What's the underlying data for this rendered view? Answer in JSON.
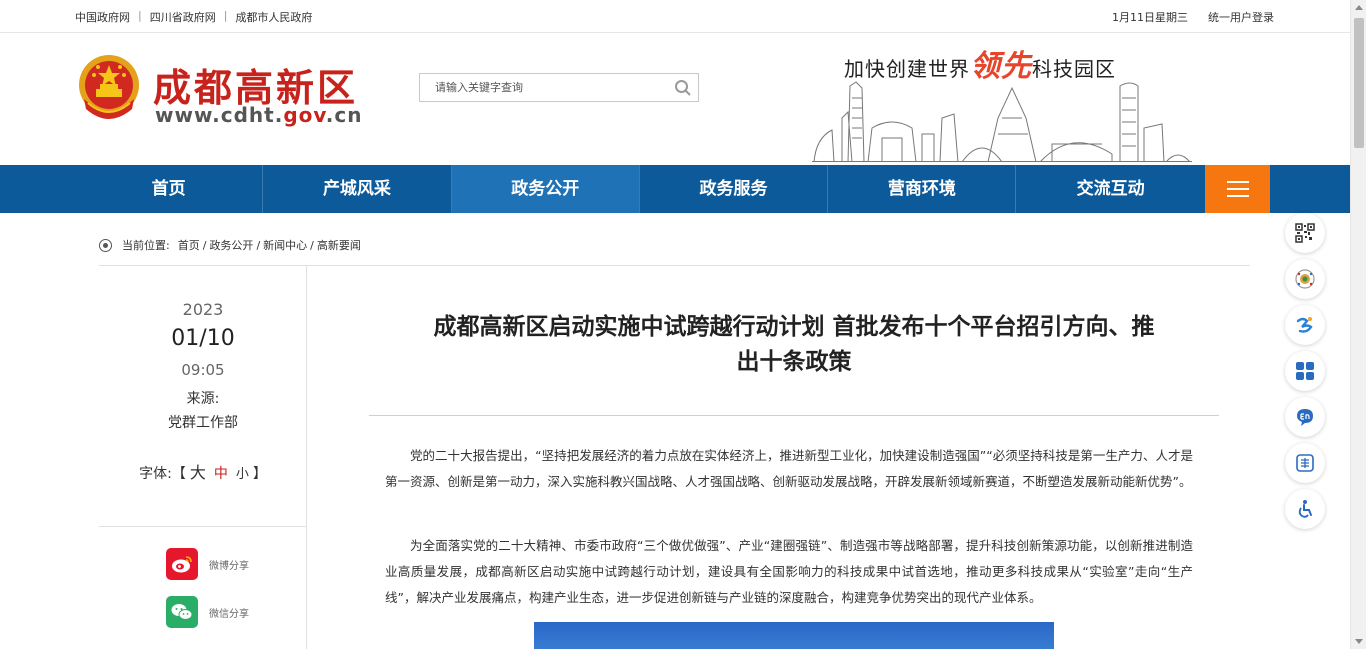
{
  "topbar": {
    "links": [
      "中国政府网",
      "四川省政府网",
      "成都市人民政府"
    ],
    "date": "1月11日星期三",
    "login": "统一用户登录"
  },
  "header": {
    "logo_cn": "成都高新区",
    "logo_url_prefix": "www.cdht.",
    "logo_url_gov": "gov",
    "logo_url_suffix": ".cn",
    "search_placeholder": "请输入关键字查询",
    "slogan_pre": "加快创建世界",
    "slogan_hl": "领先",
    "slogan_post": "科技园区"
  },
  "nav": {
    "items": [
      "首页",
      "产城风采",
      "政务公开",
      "政务服务",
      "营商环境",
      "交流互动"
    ],
    "active_index": 2
  },
  "breadcrumb": {
    "label": "当前位置:",
    "items": [
      "首页",
      "政务公开",
      "新闻中心",
      "高新要闻"
    ]
  },
  "meta": {
    "year": "2023",
    "date": "01/10",
    "time": "09:05",
    "source_label": "来源:",
    "source": "党群工作部",
    "font_label": "字体:",
    "font_open": "【",
    "font_big": "大",
    "font_mid": "中",
    "font_small": "小",
    "font_close": "】"
  },
  "share": {
    "weibo": "微博分享",
    "wechat": "微信分享"
  },
  "article": {
    "title": "成都高新区启动实施中试跨越行动计划 首批发布十个平台招引方向、推出十条政策",
    "paragraphs": [
      "党的二十大报告提出，“坚持把发展经济的着力点放在实体经济上，推进新型工业化，加快建设制造强国”“必须坚持科技是第一生产力、人才是第一资源、创新是第一动力，深入实施科教兴国战略、人才强国战略、创新驱动发展战略，开辟发展新领域新赛道，不断塑造发展新动能新优势”。",
      "为全面落实党的二十大精神、市委市政府“三个做优做强”、产业“建圈强链”、制造强市等战略部署，提升科技创新策源功能，以创新推进制造业高质量发展，成都高新区启动实施中试跨越行动计划，建设具有全国影响力的科技成果中试首选地，推动更多科技成果从“实验室”走向“生产线”，解决产业发展痛点，构建产业生态，进一步促进创新链与产业链的深度融合，构建竞争优势突出的现代产业体系。"
    ]
  },
  "colors": {
    "nav_bg": "#0d5a9a",
    "nav_active": "#1f72b6",
    "menu_orange": "#f6760f",
    "brand_red": "#c7221b"
  }
}
